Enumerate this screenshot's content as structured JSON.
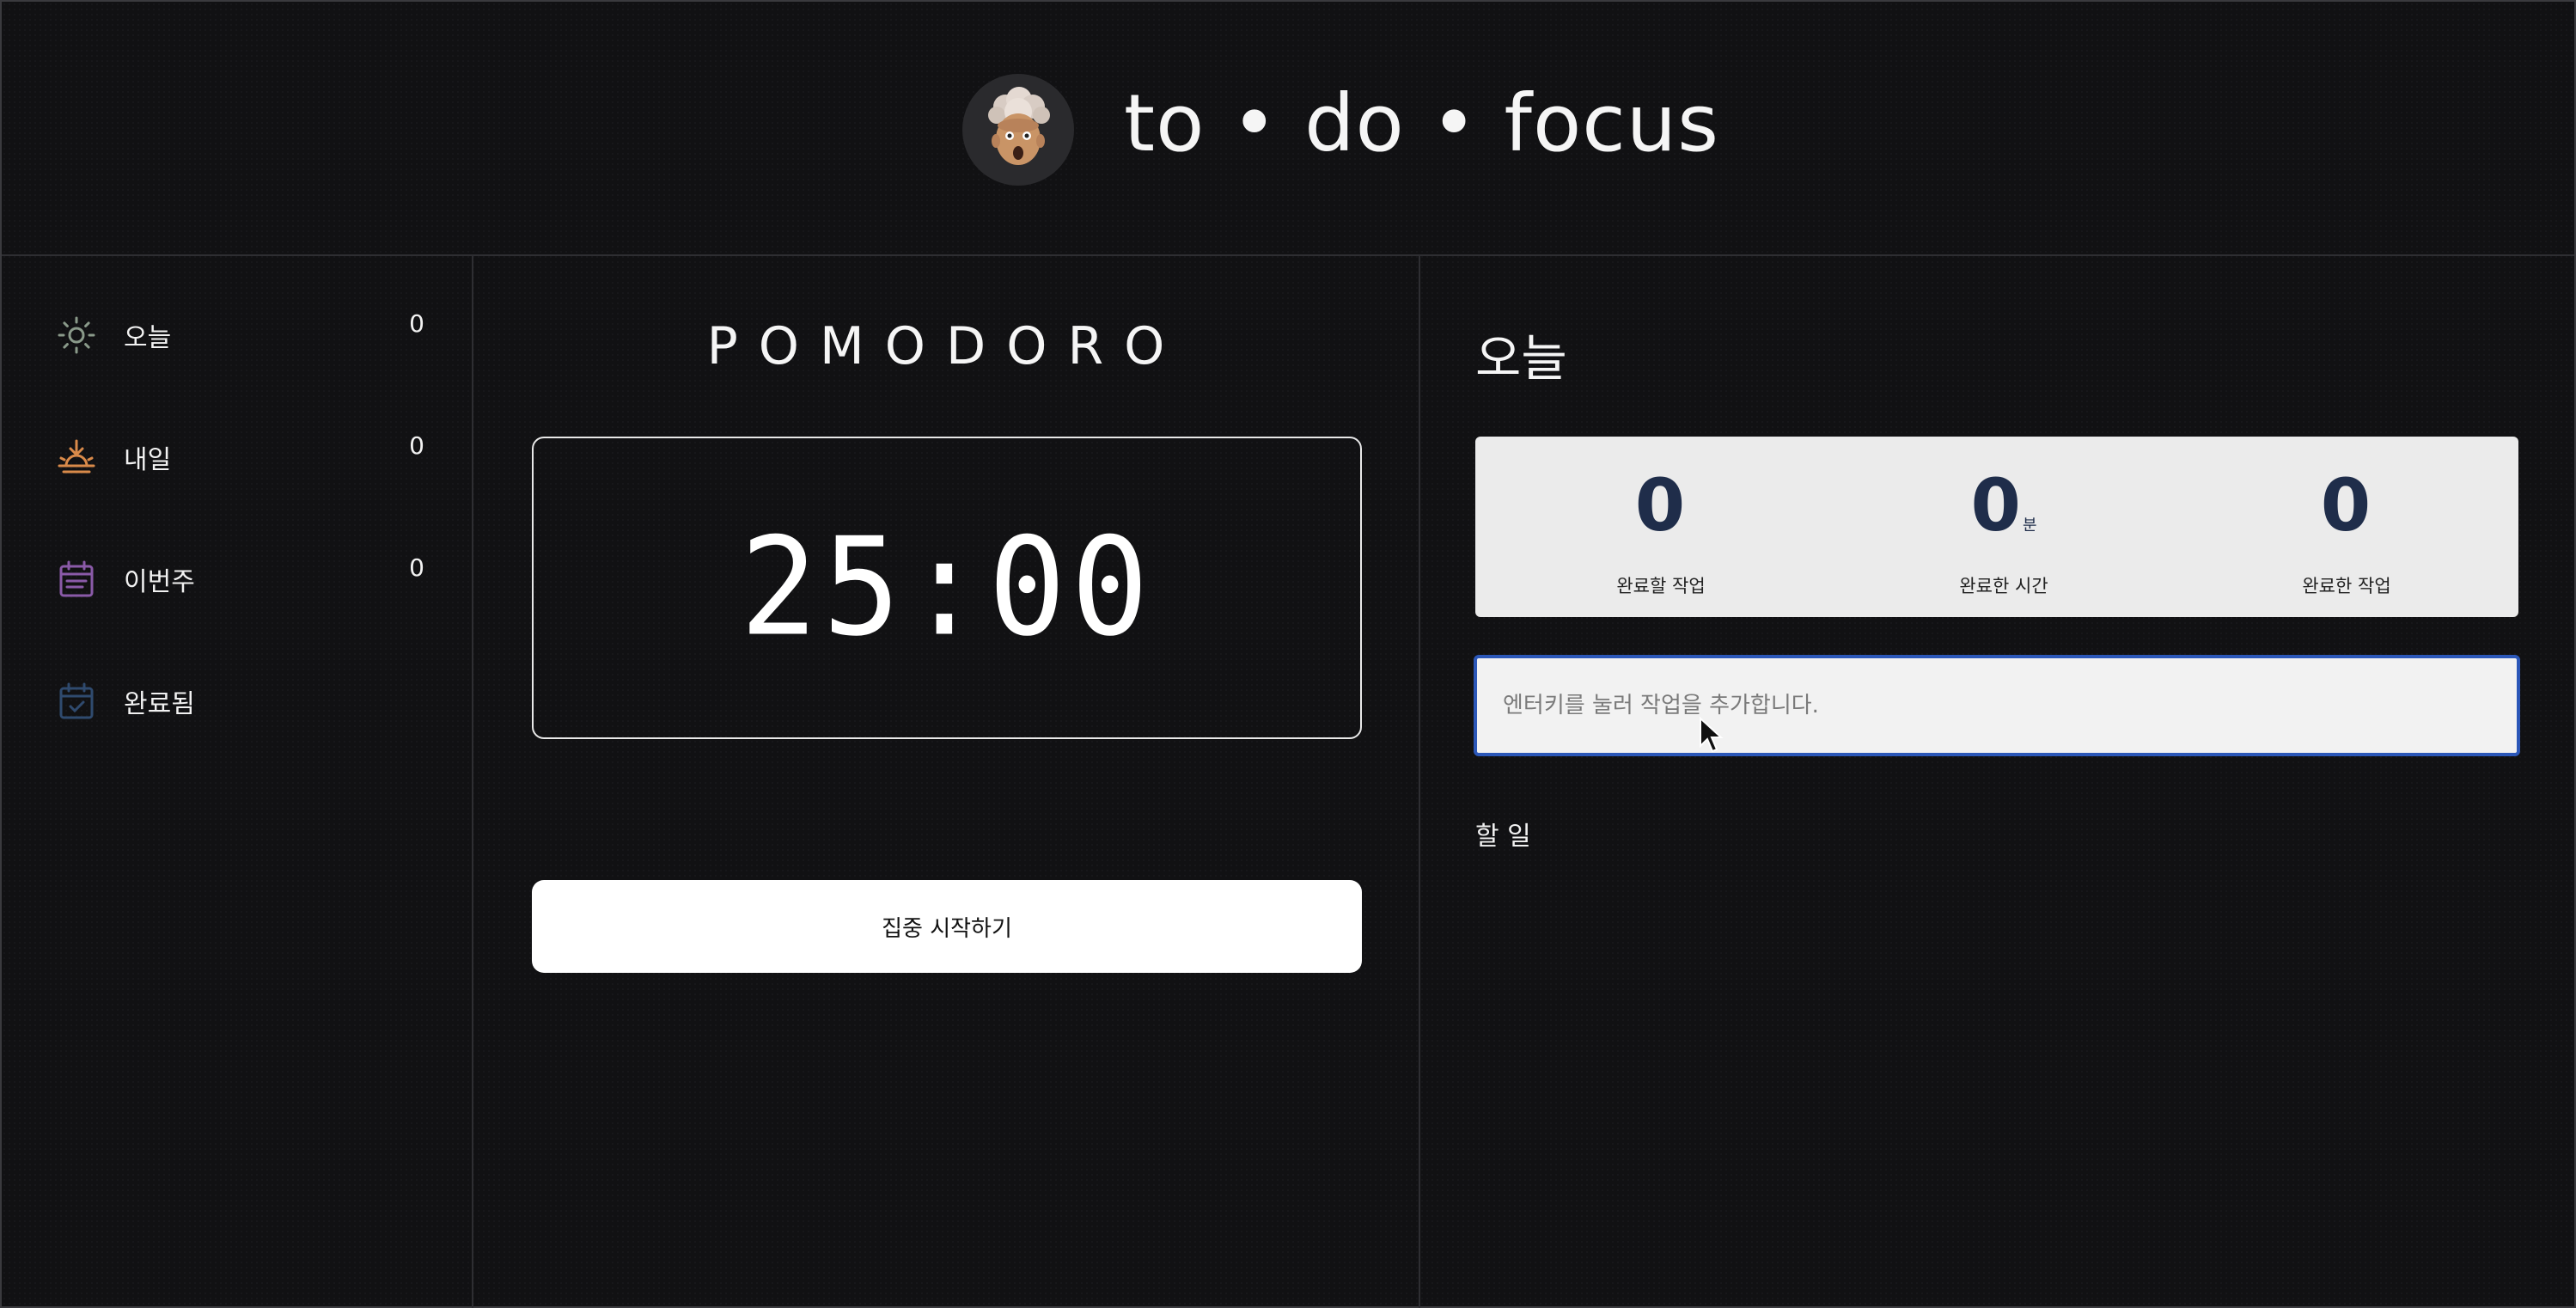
{
  "header": {
    "app_title": "to • do • focus",
    "avatar_icon": "exploding-head-avatar-icon"
  },
  "sidebar": {
    "items": [
      {
        "label": "오늘",
        "count": "0",
        "icon": "sun-icon",
        "color": "#8a9a8a"
      },
      {
        "label": "내일",
        "count": "0",
        "icon": "sunrise-icon",
        "color": "#d98a4a"
      },
      {
        "label": "이번주",
        "count": "0",
        "icon": "calendar-week-icon",
        "color": "#8a5aa8"
      },
      {
        "label": "완료됨",
        "count": "",
        "icon": "calendar-check-icon",
        "color": "#2f4a6e"
      }
    ]
  },
  "pomodoro": {
    "title": "POMODORO",
    "time": "25:00",
    "start_label": "집중 시작하기"
  },
  "main": {
    "title": "오늘",
    "stats": [
      {
        "value": "0",
        "unit": "",
        "label": "완료할 작업"
      },
      {
        "value": "0",
        "unit": "분",
        "label": "완료한 시간"
      },
      {
        "value": "0",
        "unit": "",
        "label": "완료한 작업"
      }
    ],
    "input_placeholder": "엔터키를 눌러 작업을 추가합니다.",
    "section_label": "할 일"
  },
  "colors": {
    "background": "#111113",
    "stat_number": "#1f2d4a",
    "input_focus_border": "#2b57b8"
  }
}
